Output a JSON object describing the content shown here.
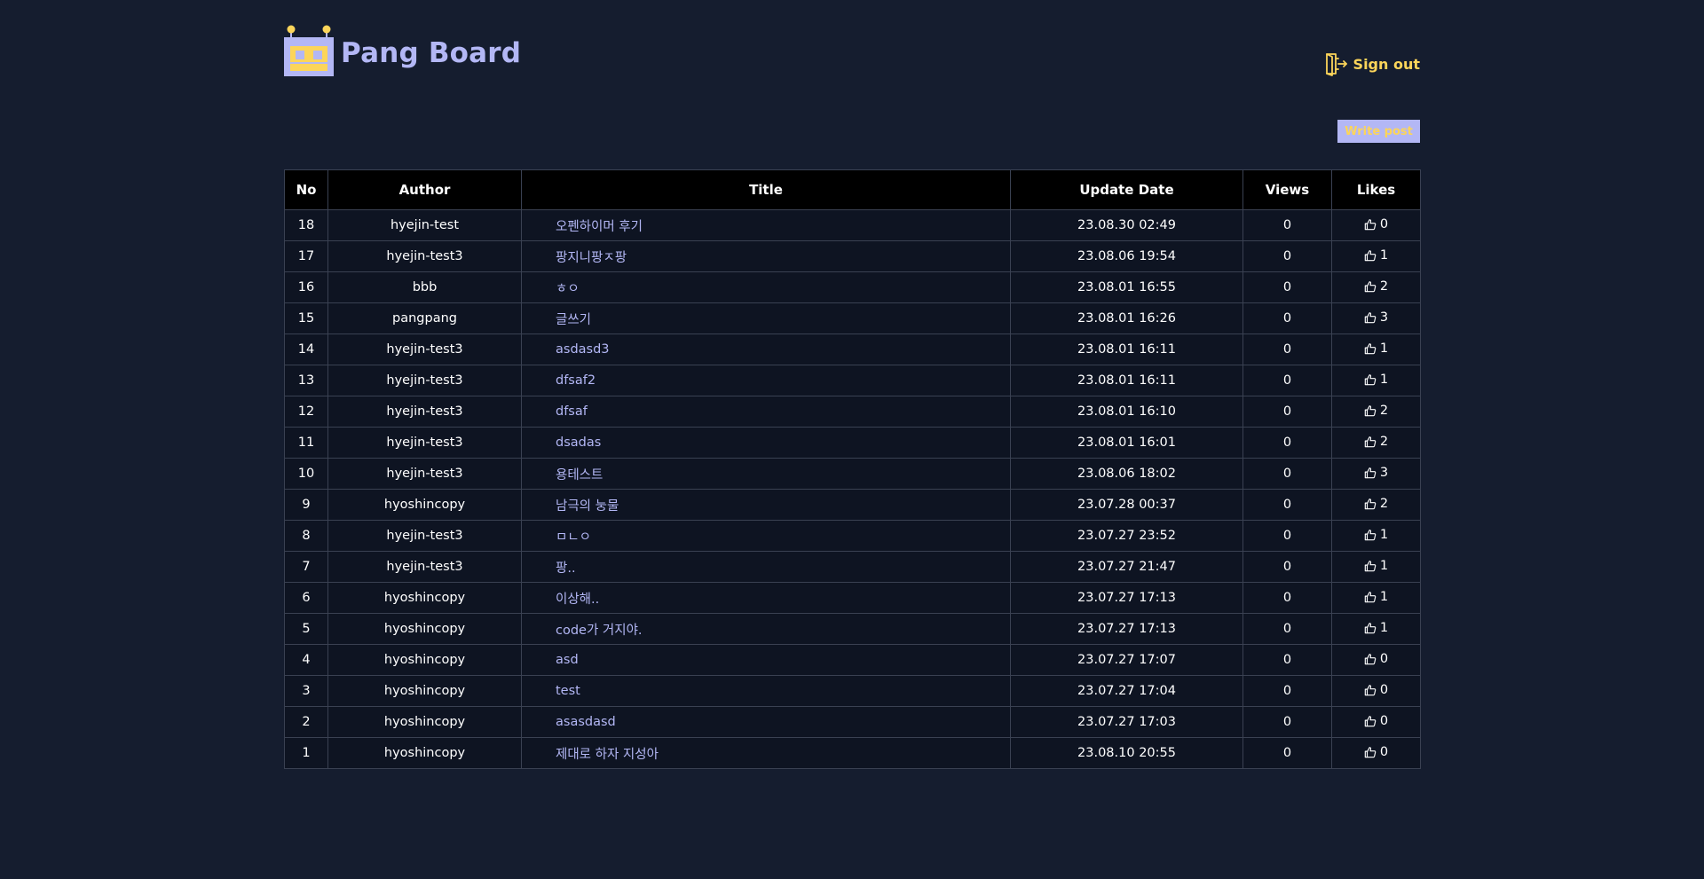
{
  "brand": {
    "title": "Pang Board",
    "logo_icon": "robot-logo-icon",
    "accent_color": "#b3b7f5",
    "highlight_color": "#fcd55a"
  },
  "header": {
    "signout_label": "Sign out",
    "signout_icon": "sign-out-icon"
  },
  "toolbar": {
    "write_label": "Write post"
  },
  "table": {
    "columns": [
      "No",
      "Author",
      "Title",
      "Update Date",
      "Views",
      "Likes"
    ],
    "rows": [
      {
        "no": "18",
        "author": "hyejin-test",
        "title": "오펜하이머 후기",
        "date": "23.08.30 02:49",
        "views": "0",
        "likes": "0"
      },
      {
        "no": "17",
        "author": "hyejin-test3",
        "title": "팡지니팡ㅈ팡",
        "date": "23.08.06 19:54",
        "views": "0",
        "likes": "1"
      },
      {
        "no": "16",
        "author": "bbb",
        "title": "ㅎㅇ",
        "date": "23.08.01 16:55",
        "views": "0",
        "likes": "2"
      },
      {
        "no": "15",
        "author": "pangpang",
        "title": "글쓰기",
        "date": "23.08.01 16:26",
        "views": "0",
        "likes": "3"
      },
      {
        "no": "14",
        "author": "hyejin-test3",
        "title": "asdasd3",
        "date": "23.08.01 16:11",
        "views": "0",
        "likes": "1"
      },
      {
        "no": "13",
        "author": "hyejin-test3",
        "title": "dfsaf2",
        "date": "23.08.01 16:11",
        "views": "0",
        "likes": "1"
      },
      {
        "no": "12",
        "author": "hyejin-test3",
        "title": "dfsaf",
        "date": "23.08.01 16:10",
        "views": "0",
        "likes": "2"
      },
      {
        "no": "11",
        "author": "hyejin-test3",
        "title": "dsadas",
        "date": "23.08.01 16:01",
        "views": "0",
        "likes": "2"
      },
      {
        "no": "10",
        "author": "hyejin-test3",
        "title": "용테스트",
        "date": "23.08.06 18:02",
        "views": "0",
        "likes": "3"
      },
      {
        "no": "9",
        "author": "hyoshincopy",
        "title": "남극의 눙물",
        "date": "23.07.28 00:37",
        "views": "0",
        "likes": "2"
      },
      {
        "no": "8",
        "author": "hyejin-test3",
        "title": "ㅁㄴㅇ",
        "date": "23.07.27 23:52",
        "views": "0",
        "likes": "1"
      },
      {
        "no": "7",
        "author": "hyejin-test3",
        "title": "팡..",
        "date": "23.07.27 21:47",
        "views": "0",
        "likes": "1"
      },
      {
        "no": "6",
        "author": "hyoshincopy",
        "title": "이상해..",
        "date": "23.07.27 17:13",
        "views": "0",
        "likes": "1"
      },
      {
        "no": "5",
        "author": "hyoshincopy",
        "title": "code가 거지야.",
        "date": "23.07.27 17:13",
        "views": "0",
        "likes": "1"
      },
      {
        "no": "4",
        "author": "hyoshincopy",
        "title": "asd",
        "date": "23.07.27 17:07",
        "views": "0",
        "likes": "0"
      },
      {
        "no": "3",
        "author": "hyoshincopy",
        "title": "test",
        "date": "23.07.27 17:04",
        "views": "0",
        "likes": "0"
      },
      {
        "no": "2",
        "author": "hyoshincopy",
        "title": "asasdasd",
        "date": "23.07.27 17:03",
        "views": "0",
        "likes": "0"
      },
      {
        "no": "1",
        "author": "hyoshincopy",
        "title": "제대로 하자 지성아",
        "date": "23.08.10 20:55",
        "views": "0",
        "likes": "0"
      }
    ]
  }
}
